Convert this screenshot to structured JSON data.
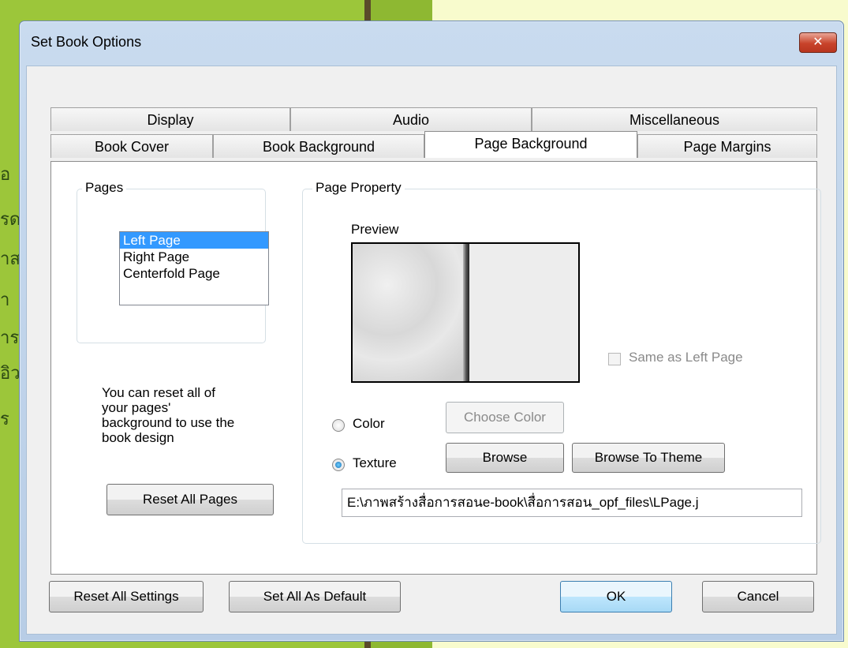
{
  "background": {
    "glyphs": [
      "อ",
      "รด",
      "าส",
      "า",
      "าร",
      "อิว",
      "ร"
    ]
  },
  "dialog": {
    "title": "Set Book Options",
    "close_label": "✕",
    "tabs_row1": [
      "Display",
      "Audio",
      "Miscellaneous"
    ],
    "tabs_row2": [
      "Book Cover",
      "Book Background",
      "Page Background",
      "Page Margins"
    ],
    "active_tab": "Page Background",
    "pages": {
      "label": "Pages",
      "items": [
        "Left Page",
        "Right Page",
        "Centerfold Page"
      ],
      "selected": "Left Page"
    },
    "reset_note": [
      "You can reset all of",
      "your pages'",
      "background to use the",
      "book design"
    ],
    "reset_pages_button": "Reset All Pages",
    "page_property": {
      "label": "Page Property",
      "preview_label": "Preview",
      "same_as_left_label": "Same as Left Page",
      "same_as_left_checked": false,
      "color_label": "Color",
      "texture_label": "Texture",
      "selected_option": "Texture",
      "choose_color_button": "Choose Color",
      "browse_button": "Browse",
      "browse_theme_button": "Browse To Theme",
      "texture_path": "E:\\ภาพสร้างสื่อการสอนe-book\\สื่อการสอน_opf_files\\LPage.j"
    },
    "footer": {
      "reset_all_settings": "Reset All Settings",
      "set_all_default": "Set All As Default",
      "ok": "OK",
      "cancel": "Cancel"
    }
  }
}
